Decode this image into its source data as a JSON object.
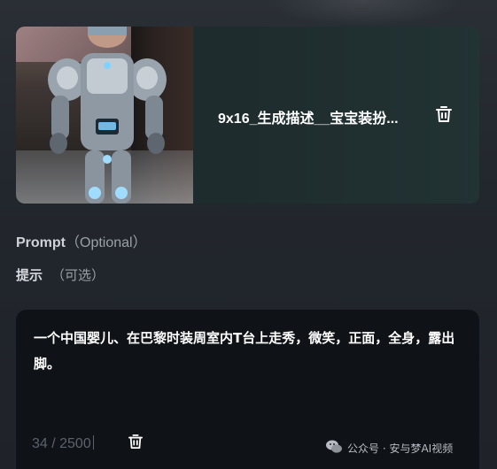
{
  "upload": {
    "file_name": "9x16_生成描述__宝宝装扮...",
    "thumbnail_icon": "robot-costume-child-photo",
    "delete_icon": "trash-icon"
  },
  "prompt": {
    "label": "Prompt",
    "optional": "（Optional）",
    "hint_label": "提示",
    "hint_optional": "（可选）",
    "text": "一个中国婴儿、在巴黎时装周室内T台上走秀，微笑，正面，全身，露出脚。",
    "counter": "34 / 2500"
  },
  "watermark": {
    "text": "公众号 · 安与梦AI视频",
    "icon": "wechat-icon"
  },
  "colors": {
    "card_bg": "#1f2d2e",
    "textarea_bg": "#0f1217",
    "accent_text": "#ffffff"
  }
}
